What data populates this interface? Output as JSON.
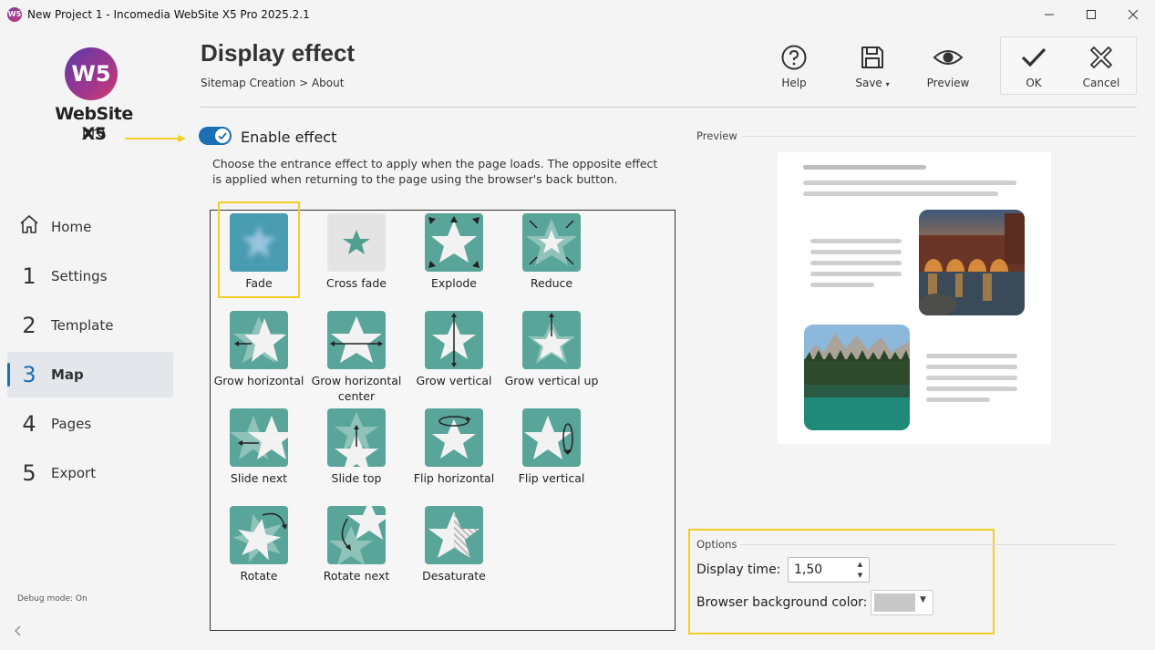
{
  "window": {
    "title": "New Project 1 - Incomedia WebSite X5 Pro 2025.2.1",
    "app_icon": "W5"
  },
  "logo": {
    "mark": "W5",
    "line1": "WebSite X5",
    "line2": "pro"
  },
  "nav": {
    "items": [
      {
        "num": "",
        "label": "Home",
        "icon": "home-icon"
      },
      {
        "num": "1",
        "label": "Settings"
      },
      {
        "num": "2",
        "label": "Template"
      },
      {
        "num": "3",
        "label": "Map",
        "active": true
      },
      {
        "num": "4",
        "label": "Pages"
      },
      {
        "num": "5",
        "label": "Export"
      }
    ],
    "debug": "Debug mode: On"
  },
  "header": {
    "title": "Display effect",
    "breadcrumb": "Sitemap Creation > About"
  },
  "toolbar": {
    "help": "Help",
    "save": "Save",
    "preview": "Preview",
    "ok": "OK",
    "cancel": "Cancel"
  },
  "effect": {
    "enable_label": "Enable effect",
    "enabled": true,
    "description": "Choose the entrance effect to apply when the page loads. The opposite effect is applied when returning to the page using the browser's back button.",
    "selected": "Fade",
    "items": [
      "Fade",
      "Cross fade",
      "Explode",
      "Reduce",
      "Grow horizontal",
      "Grow horizontal center",
      "Grow vertical",
      "Grow vertical up",
      "Slide next",
      "Slide top",
      "Flip horizontal",
      "Flip vertical",
      "Rotate",
      "Rotate next",
      "Desaturate"
    ]
  },
  "preview": {
    "label": "Preview"
  },
  "options": {
    "label": "Options",
    "display_time_label": "Display time:",
    "display_time_value": "1,50",
    "bg_color_label": "Browser background color:",
    "bg_color": "#c8c8c8"
  },
  "colors": {
    "accent": "#1a6fb5",
    "highlight": "#f3cf23",
    "thumb": "#5aa59a",
    "fade_thumb": "#4a9bb0"
  }
}
